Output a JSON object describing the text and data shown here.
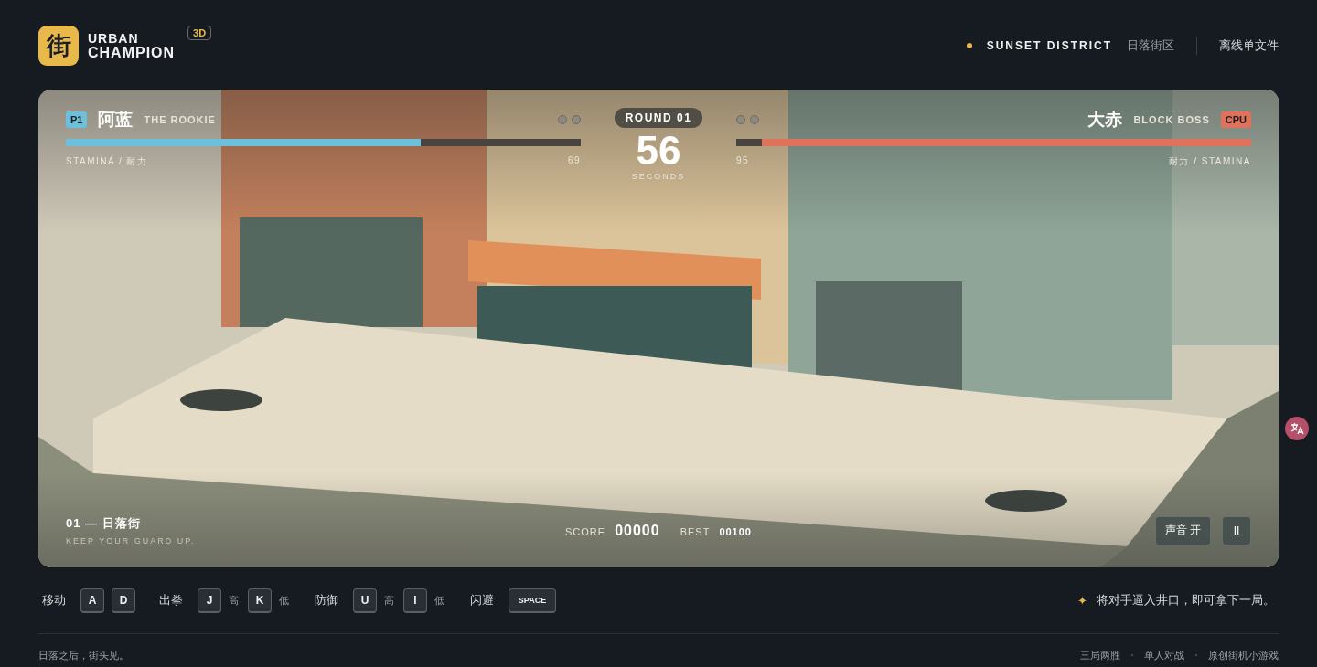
{
  "header": {
    "logo_glyph": "街",
    "title_lines": [
      "URBAN",
      "CHAMPION"
    ],
    "badge": "3D",
    "district": "SUNSET DISTRICT",
    "district_cn": "日落街区",
    "link": "离线单文件"
  },
  "hud": {
    "round": "ROUND 01",
    "timer": "56",
    "timer_label": "SECONDS",
    "players": [
      {
        "kind": "human",
        "tag": "P1",
        "name": "阿蓝",
        "subtitle": "THE ROOKIE",
        "level": 0.69,
        "reading": "69",
        "caption": "STAMINA / 耐力",
        "wins": [
          {
            "won": false
          },
          {
            "won": false
          }
        ]
      },
      {
        "kind": "cpu",
        "tag": "CPU",
        "name": "大赤",
        "subtitle": "BLOCK BOSS",
        "level": 0.95,
        "reading": "95",
        "caption": "耐力 / STAMINA",
        "wins": [
          {
            "won": false
          },
          {
            "won": false
          }
        ]
      }
    ],
    "stage": "01 — 日落街",
    "stage_sub": "KEEP YOUR GUARD UP.",
    "score_label": "SCORE",
    "score": "00000",
    "best_label": "BEST",
    "best": "00100",
    "buttons": [
      {
        "label": "声音 开"
      },
      {
        "label": "II"
      }
    ]
  },
  "controls": [
    {
      "label": "移动",
      "keys": [
        {
          "key": "A"
        },
        {
          "key": "D"
        }
      ]
    },
    {
      "label": "出拳",
      "keys": [
        {
          "key": "J",
          "note": "高"
        },
        {
          "key": "K",
          "note": "低"
        }
      ]
    },
    {
      "label": "防御",
      "keys": [
        {
          "key": "U",
          "note": "高"
        },
        {
          "key": "I",
          "note": "低"
        }
      ]
    },
    {
      "label": "闪避",
      "keys": [
        {
          "key": "SPACE"
        }
      ]
    }
  ],
  "hint": {
    "icon": "✦",
    "text": "将对手逼入井口，即可拿下一局。"
  },
  "footer": {
    "tagline": "日落之后，街头见。",
    "links": [
      "三局两胜",
      "单人对战",
      "原创街机小游戏"
    ]
  }
}
